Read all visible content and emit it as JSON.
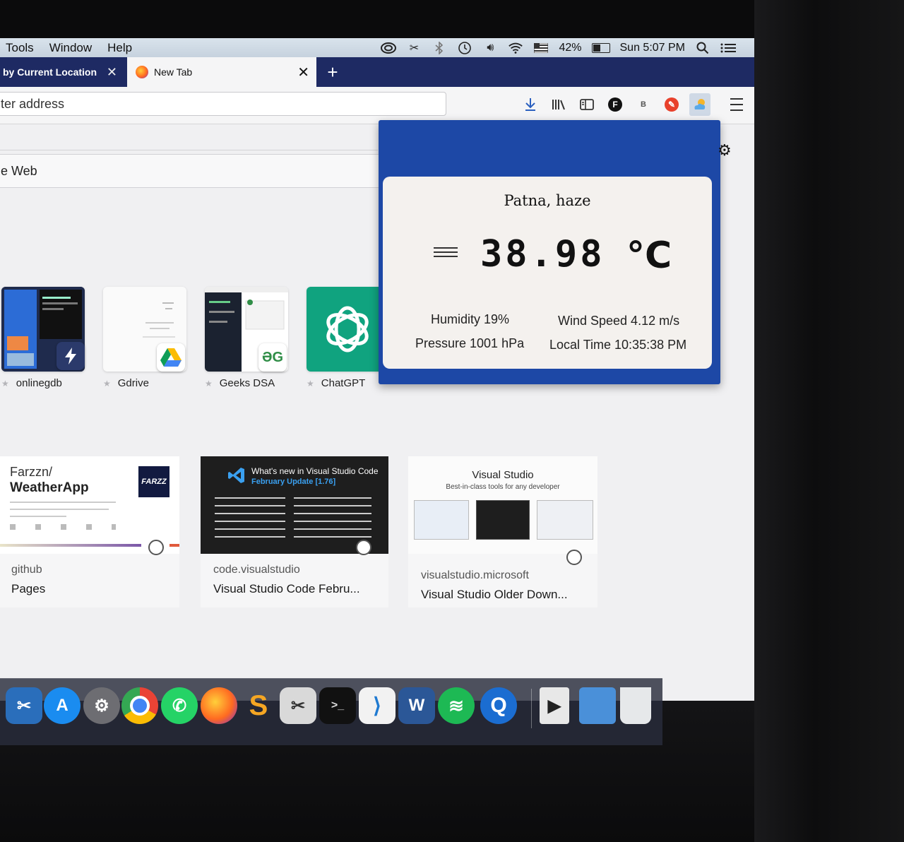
{
  "menubar": {
    "items": [
      "Tools",
      "Window",
      "Help"
    ],
    "battery": "42%",
    "clock": "Sun 5:07 PM",
    "battery_level": 0.42
  },
  "tabs": [
    {
      "label": "by Current Location",
      "close": "✕"
    },
    {
      "label": "New Tab",
      "close": "✕"
    }
  ],
  "new_tab_symbol": "+",
  "navbar": {
    "address_placeholder": "ter address",
    "extensions": [
      {
        "icon": "download-icon"
      },
      {
        "icon": "library-icon"
      },
      {
        "icon": "sidebar-icon"
      },
      {
        "icon": "f-extension-icon",
        "text": "F",
        "color": "#111111"
      },
      {
        "icon": "b-extension-icon",
        "text": "B",
        "color": "#555555"
      },
      {
        "icon": "red-extension-icon",
        "color": "#e8412c"
      },
      {
        "icon": "weather-extension-icon"
      }
    ]
  },
  "newtab": {
    "search_text": "e Web",
    "top_sites": [
      {
        "name": "onlinegdb"
      },
      {
        "name": "Gdrive"
      },
      {
        "name": "Geeks DSA"
      },
      {
        "name": "ChatGPT"
      }
    ],
    "highlights": [
      {
        "heading_line1": "Farzzn/",
        "heading_line2": "WeatherApp",
        "logo_text": "FARZZ",
        "source": "github",
        "title": "Pages"
      },
      {
        "banner_title": "What's new in Visual Studio Code",
        "banner_sub": "February Update [1.76]",
        "source": "code.visualstudio",
        "title": "Visual Studio Code Febru..."
      },
      {
        "banner_title": "Visual Studio",
        "banner_sub": "Best-in-class tools for any developer",
        "source": "visualstudio.microsoft",
        "title": "Visual Studio Older Down..."
      }
    ]
  },
  "weather": {
    "location": "Patna, haze",
    "temperature": "38.98",
    "unit": "°C",
    "humidity": "Humidity 19%",
    "wind": "Wind Speed 4.12 m/s",
    "pressure": "Pressure 1001 hPa",
    "local_time": "Local Time 10:35:38 PM",
    "header_color": "#1d48a6"
  },
  "dock": [
    "scissors-app-icon",
    "app-store-icon",
    "system-preferences-icon",
    "chrome-icon",
    "whatsapp-icon",
    "firefox-icon",
    "sublime-text-icon",
    "screenshot-icon",
    "terminal-icon",
    "vscode-icon",
    "word-icon",
    "spotify-icon",
    "quicktime-icon",
    "media-file-icon",
    "folder-icon",
    "trash-icon"
  ]
}
